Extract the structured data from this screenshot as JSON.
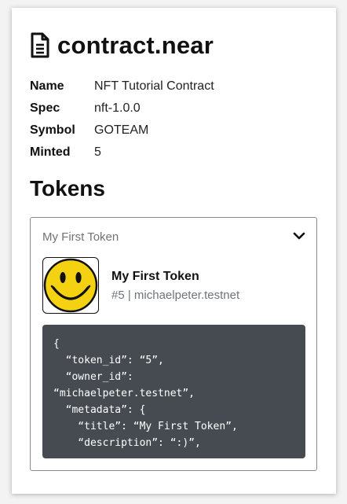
{
  "contract": {
    "title": "contract.near",
    "meta": [
      {
        "key": "Name",
        "value": "NFT Tutorial Contract"
      },
      {
        "key": "Spec",
        "value": "nft-1.0.0"
      },
      {
        "key": "Symbol",
        "value": "GOTEAM"
      },
      {
        "key": "Minted",
        "value": "5"
      }
    ]
  },
  "tokens": {
    "heading": "Tokens",
    "items": [
      {
        "accordion_title": "My First Token",
        "name": "My First Token",
        "subtitle": "#5 | michaelpeter.testnet",
        "image": "smiley-face",
        "json_lines": [
          "{",
          "  “token_id”: “5”,",
          "  “owner_id”:",
          "“michaelpeter.testnet”,",
          "  “metadata”: {",
          "    “title”: “My First Token”,",
          "    “description”: “:)”,"
        ]
      }
    ]
  },
  "icons": {
    "document": "document-icon",
    "expand": "chevron-down-icon"
  },
  "colors": {
    "code_background": "#454b51",
    "muted_text": "#6f7479",
    "smiley_yellow": "#f5d211"
  }
}
